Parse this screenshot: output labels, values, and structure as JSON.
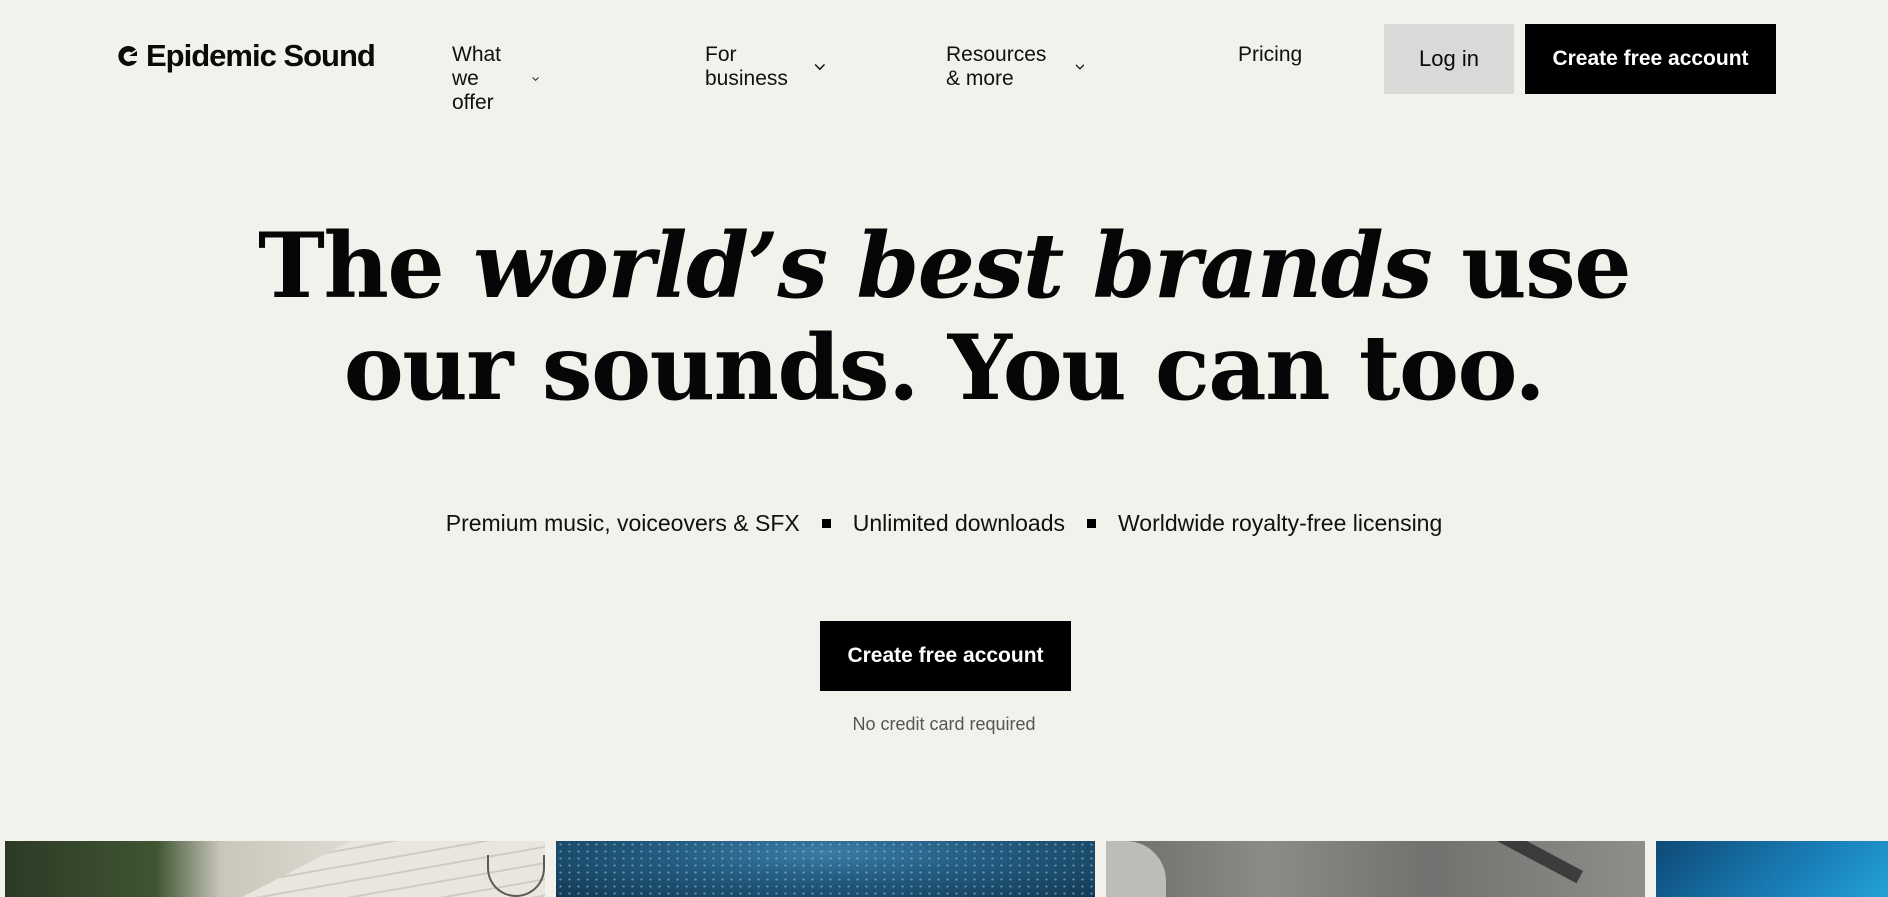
{
  "brand": {
    "name": "Epidemic Sound",
    "logo_icon": "epidemic-sound-logo-icon"
  },
  "nav": {
    "items": [
      {
        "label": "What we offer",
        "has_dropdown": true
      },
      {
        "label": "For business",
        "has_dropdown": true
      },
      {
        "label": "Resources & more",
        "has_dropdown": true
      },
      {
        "label": "Pricing",
        "has_dropdown": false
      }
    ],
    "login_label": "Log in",
    "create_account_label": "Create free account"
  },
  "hero": {
    "title_line1_start": "The ",
    "title_line1_emphasis": "world’s best brands",
    "title_line1_end": " use",
    "title_line2": "our sounds. You can too.",
    "features": [
      "Premium music, voiceovers & SFX",
      "Unlimited downloads",
      "Worldwide royalty-free licensing"
    ],
    "cta_label": "Create free account",
    "cta_note": "No credit card required"
  },
  "colors": {
    "background": "#f2f1ec",
    "primary_button": "#000000",
    "secondary_button": "#d8dad8",
    "text": "#0a0a0a"
  }
}
